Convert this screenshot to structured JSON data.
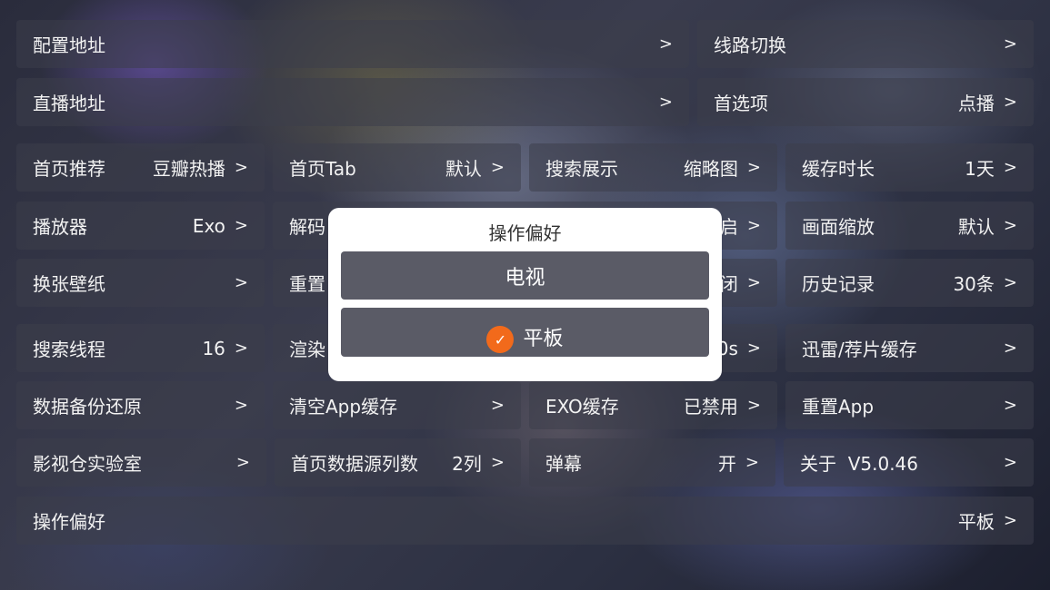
{
  "rows": {
    "config_url": {
      "label": "配置地址",
      "arrow": ">"
    },
    "line_switch": {
      "label": "线路切换",
      "arrow": ">"
    },
    "live_url": {
      "label": "直播地址",
      "arrow": ">"
    },
    "preference": {
      "label": "首选项",
      "value": "点播",
      "arrow": ">"
    },
    "home_recommend": {
      "label": "首页推荐",
      "value": "豆瓣热播",
      "arrow": ">"
    },
    "home_tab": {
      "label": "首页Tab",
      "value": "默认",
      "arrow": ">"
    },
    "search_display": {
      "label": "搜索展示",
      "value": "缩略图",
      "arrow": ">"
    },
    "cache_duration": {
      "label": "缓存时长",
      "value": "1天",
      "arrow": ">"
    },
    "player": {
      "label": "播放器",
      "value": "Exo",
      "arrow": ">"
    },
    "decode": {
      "label": "解码",
      "value": "启",
      "arrow": ">"
    },
    "screen_scale": {
      "label": "画面缩放",
      "value": "默认",
      "arrow": ">"
    },
    "wallpaper": {
      "label": "换张壁纸",
      "arrow": ">"
    },
    "reset_col2": {
      "label": "重置",
      "value": "闭",
      "arrow": ">"
    },
    "history": {
      "label": "历史记录",
      "value": "30条",
      "arrow": ">"
    },
    "search_threads": {
      "label": "搜索线程",
      "value": "16",
      "arrow": ">"
    },
    "render": {
      "label": "渲染",
      "value": "0s",
      "arrow": ">"
    },
    "xunlei_cache": {
      "label": "迅雷/荐片缓存",
      "arrow": ">"
    },
    "backup_restore": {
      "label": "数据备份还原",
      "arrow": ">"
    },
    "clear_cache": {
      "label": "清空App缓存",
      "arrow": ">"
    },
    "exo_cache": {
      "label": "EXO缓存",
      "value": "已禁用",
      "arrow": ">"
    },
    "reset_app": {
      "label": "重置App",
      "arrow": ">"
    },
    "lab": {
      "label": "影视仓实验室",
      "arrow": ">"
    },
    "home_columns": {
      "label": "首页数据源列数",
      "value": "2列",
      "arrow": ">"
    },
    "danmaku": {
      "label": "弹幕",
      "value": "开",
      "arrow": ">"
    },
    "about": {
      "label": "关于  V5.0.46",
      "arrow": ">"
    },
    "operation_pref": {
      "label": "操作偏好",
      "value": "平板",
      "arrow": ">"
    }
  },
  "dialog": {
    "title": "操作偏好",
    "options": [
      {
        "label": "电视",
        "selected": false
      },
      {
        "label": "平板",
        "selected": true
      }
    ],
    "check_glyph": "✓",
    "accent": "#f26a1b"
  }
}
